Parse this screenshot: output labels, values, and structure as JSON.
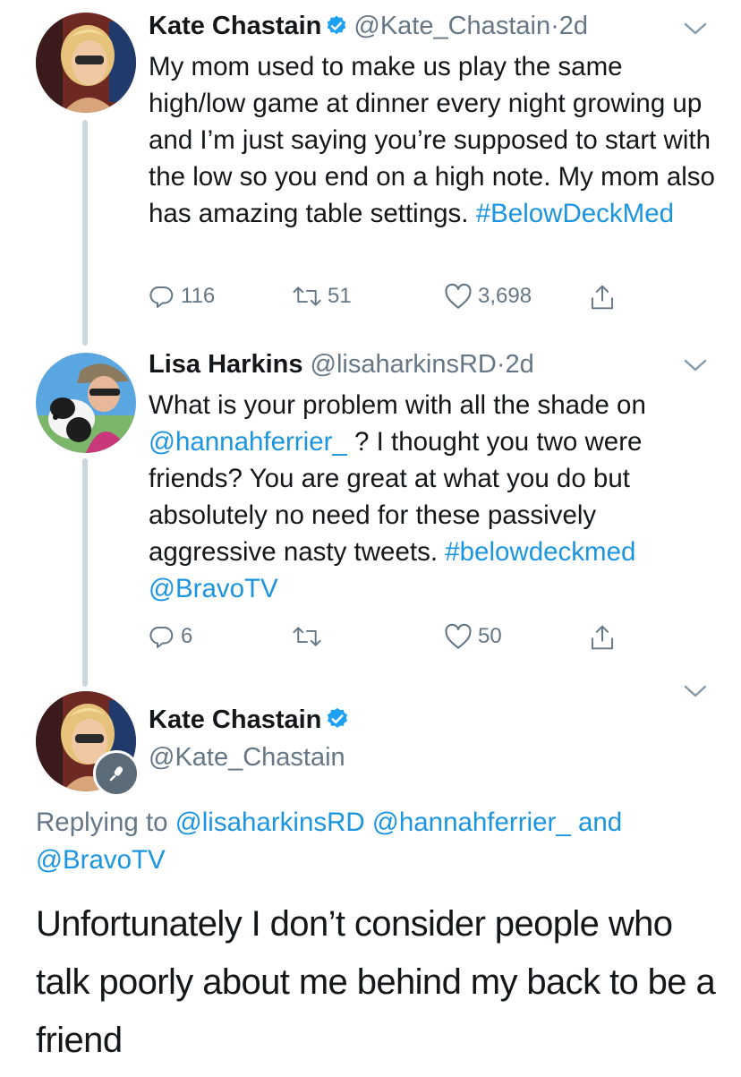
{
  "tweets": [
    {
      "name": "Kate Chastain",
      "handle": "@Kate_Chastain",
      "dot": "·",
      "time": "2d",
      "text": "My mom used to make us play the same high/low game at dinner every night growing up and I’m just saying you’re supposed to start with the low so you end on a high note. My mom also has amazing table settings.",
      "hashtag": "#BelowDeckMed",
      "replies": "116",
      "retweets": "51",
      "likes": "3,698"
    },
    {
      "name": "Lisa Harkins",
      "handle": "@lisaharkinsRD",
      "dot": "·",
      "time": "2d",
      "text_part1": "What is your problem with all the shade on",
      "mention1": "@hannahferrier_",
      "text_part2": " ? I thought you two were friends? You are great at what you do but absolutely no need for these passively aggressive nasty tweets.",
      "hashtag": "#belowdeckmed",
      "mention2": "@BravoTV",
      "replies": "6",
      "retweets": "",
      "likes": "50"
    }
  ],
  "main_tweet": {
    "name": "Kate Chastain",
    "handle": "@Kate_Chastain",
    "replying_label": "Replying to",
    "reply_mention1": "@lisaharkinsRD",
    "reply_mention2": "@hannahferrier_",
    "reply_and": "and",
    "reply_mention3": "@BravoTV",
    "text": "Unfortunately I don’t consider people who talk poorly about me behind my back to be a friend"
  },
  "icons": {
    "verified": "verified-badge-icon",
    "reply": "reply-bubble-icon",
    "retweet": "retweet-icon",
    "like": "heart-icon",
    "share": "share-icon",
    "more": "chevron-down-icon",
    "mic": "microphone-icon"
  },
  "colors": {
    "link": "#1b95e0",
    "secondary_text": "#657786",
    "thread_line": "#ccd6dd",
    "verified": "#1da1f2"
  }
}
